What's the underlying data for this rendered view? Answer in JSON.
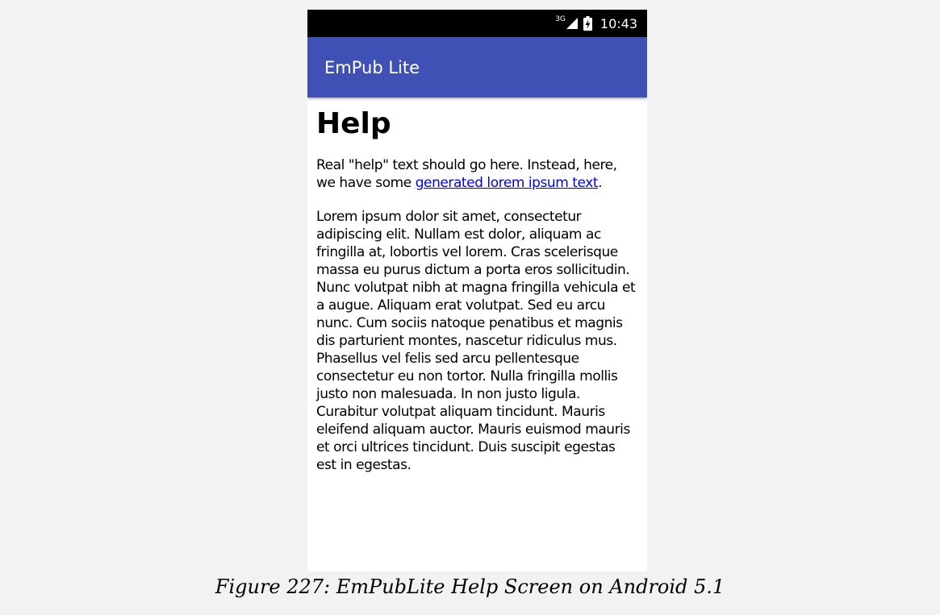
{
  "status_bar": {
    "network_type": "3G",
    "time": "10:43",
    "icons": [
      "signal-icon",
      "battery-charging-icon"
    ]
  },
  "app_bar": {
    "title": "EmPub Lite",
    "color": "#3f51b5"
  },
  "help": {
    "heading": "Help",
    "intro_before_link": "Real \"help\" text should go here. Instead, here, we have some ",
    "link_text": "generated lorem ipsum text",
    "intro_after_link": ".",
    "body": "Lorem ipsum dolor sit amet, consectetur adipiscing elit. Nullam est dolor, aliquam ac fringilla at, lobortis vel lorem. Cras scelerisque massa eu purus dictum a porta eros sollicitudin. Nunc volutpat nibh at magna fringilla vehicula et a augue. Aliquam erat volutpat. Sed eu arcu nunc. Cum sociis natoque penatibus et magnis dis parturient montes, nascetur ridiculus mus. Phasellus vel felis sed arcu pellentesque consectetur eu non tortor. Nulla fringilla mollis justo non malesuada. In non justo ligula. Curabitur volutpat aliquam tincidunt. Mauris eleifend aliquam auctor. Mauris euismod mauris et orci ultrices tincidunt. Duis suscipit egestas est in egestas."
  },
  "caption": "Figure 227: EmPubLite Help Screen on Android 5.1"
}
